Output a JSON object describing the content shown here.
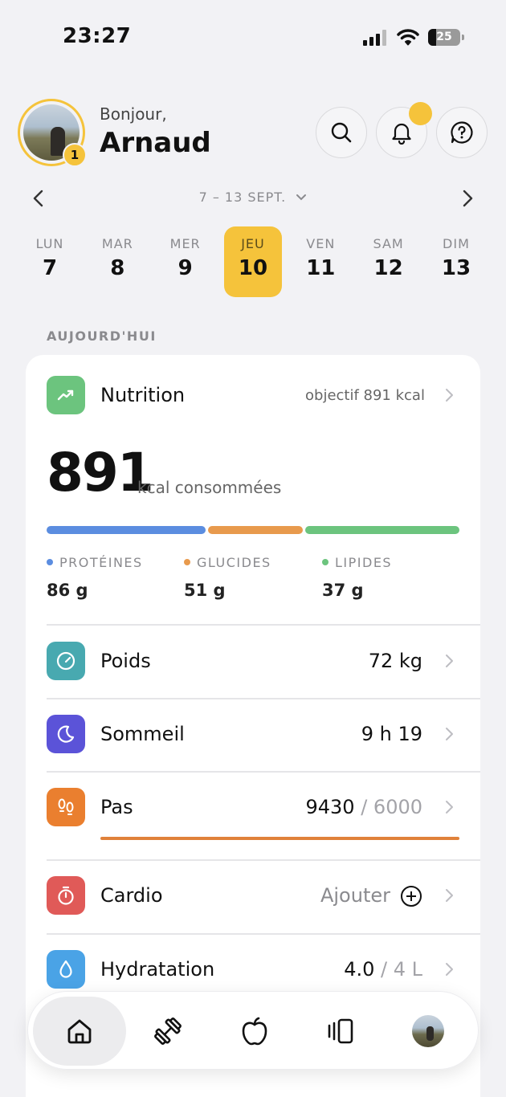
{
  "status_bar": {
    "time": "23:27",
    "battery": "25"
  },
  "header": {
    "greeting": "Bonjour,",
    "user_name": "Arnaud",
    "avatar_badge": "1",
    "icons": [
      "search-icon",
      "bell-icon",
      "help-icon"
    ]
  },
  "week": {
    "range_label": "7 – 13 SEPT.",
    "days": [
      {
        "name": "LUN",
        "num": "7"
      },
      {
        "name": "MAR",
        "num": "8"
      },
      {
        "name": "MER",
        "num": "9"
      },
      {
        "name": "JEU",
        "num": "10",
        "active": true
      },
      {
        "name": "VEN",
        "num": "11"
      },
      {
        "name": "SAM",
        "num": "12"
      },
      {
        "name": "DIM",
        "num": "13"
      }
    ]
  },
  "section_title": "AUJOURD'HUI",
  "nutrition": {
    "title": "Nutrition",
    "goal": "objectif 891 kcal",
    "kcal": "891",
    "kcal_unit": "kcal consommées",
    "macros": [
      {
        "label": "PROTÉINES",
        "value": "86 g",
        "color": "#5b8de0"
      },
      {
        "label": "GLUCIDES",
        "value": "51 g",
        "color": "#e89a4d"
      },
      {
        "label": "LIPIDES",
        "value": "37 g",
        "color": "#6cc47e"
      }
    ]
  },
  "rows": {
    "weight": {
      "title": "Poids",
      "value": "72 kg",
      "color": "#48a9b0"
    },
    "sleep": {
      "title": "Sommeil",
      "value": "9 h 19",
      "color": "#5b53d8"
    },
    "steps": {
      "title": "Pas",
      "value": "9430",
      "goal": "/ 6000",
      "progress": 1.0,
      "color": "#ea7f2f"
    },
    "cardio": {
      "title": "Cardio",
      "action": "Ajouter",
      "color": "#e05a58"
    },
    "hydration": {
      "title": "Hydratation",
      "value": "4.0",
      "goal": "/ 4 L",
      "color": "#4aa3e6"
    }
  },
  "tabbar": [
    "home-icon",
    "dumbbell-icon",
    "apple-icon",
    "cards-icon",
    "profile-avatar"
  ]
}
